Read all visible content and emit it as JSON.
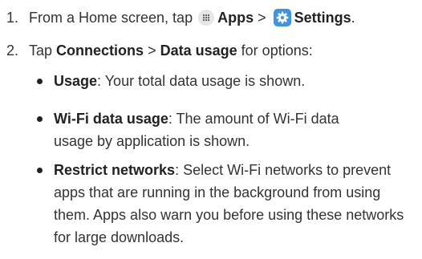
{
  "steps": [
    {
      "number": "1.",
      "prefix": "From a Home screen, tap",
      "apps_label": "Apps",
      "separator": ">",
      "settings_label": "Settings",
      "suffix": "."
    },
    {
      "number": "2.",
      "prefix": "Tap",
      "connections_label": "Connections",
      "separator": ">",
      "data_usage_label": "Data usage",
      "suffix": "for options:"
    }
  ],
  "bullets": [
    {
      "term": "Usage",
      "text": ": Your total data usage is shown."
    },
    {
      "term": "Wi-Fi data usage",
      "text": ": The amount of Wi-Fi data usage by application is shown."
    },
    {
      "term": "Restrict networks",
      "text": ": Select Wi-Fi networks to prevent apps that are running in the background from using them. Apps also warn you before using these networks for large downloads."
    }
  ],
  "icons": {
    "apps": "apps-grid-icon",
    "settings": "settings-gear-icon",
    "settings_color": "#3d94e6"
  }
}
